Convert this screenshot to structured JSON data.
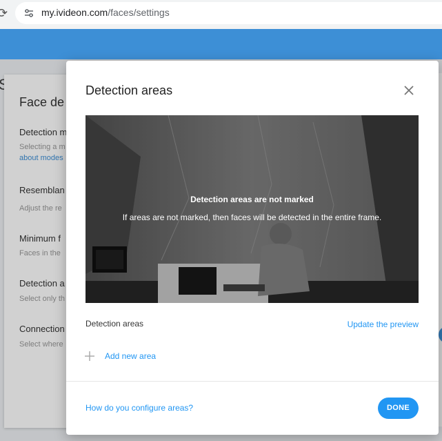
{
  "browser": {
    "url_host": "my.ivideon.com",
    "url_path": "/faces/settings"
  },
  "background": {
    "partial_heading": "S",
    "card_title": "Face de",
    "rows": [
      {
        "label": "Detection m",
        "sub": "Selecting a m",
        "link": "about modes"
      },
      {
        "label": "Resemblan",
        "sub": "Adjust the re"
      },
      {
        "label": "Minimum f",
        "sub": "Faces in the"
      },
      {
        "label": "Detection a",
        "sub": "Select only th"
      },
      {
        "label": "Connection",
        "sub": "Select where"
      }
    ]
  },
  "modal": {
    "title": "Detection areas",
    "preview": {
      "message_title": "Detection areas are not marked",
      "message_body": "If areas are not marked, then faces will be detected in the entire frame."
    },
    "areas_label": "Detection areas",
    "update_preview": "Update the preview",
    "add_area": "Add new area",
    "help_link": "How do you configure areas?",
    "done": "DONE"
  },
  "colors": {
    "accent": "#2196f3",
    "header": "#3d8fd6"
  },
  "icons": {
    "close": "close-icon",
    "add": "plus-icon",
    "site_settings": "tune-icon",
    "reload": "reload-icon"
  }
}
